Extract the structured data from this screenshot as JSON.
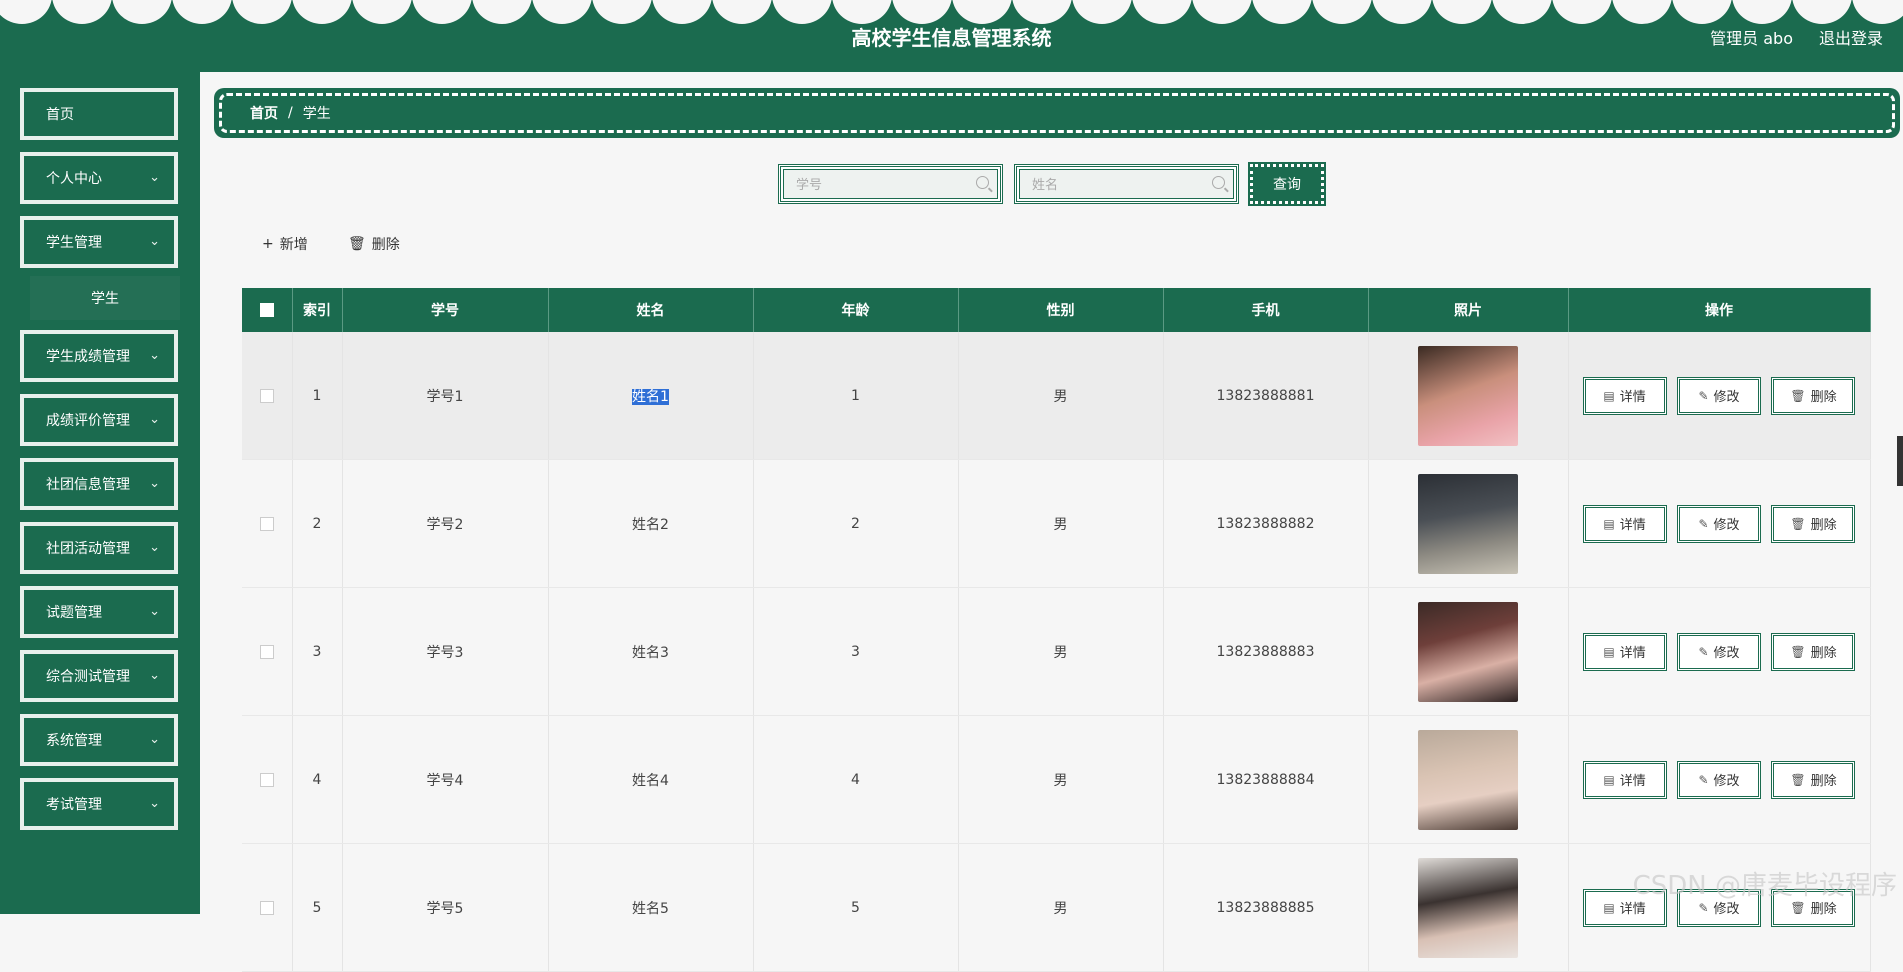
{
  "header": {
    "title": "高校学生信息管理系统",
    "admin_label": "管理员 abo",
    "logout_label": "退出登录"
  },
  "sidebar": {
    "items": [
      {
        "label": "首页",
        "expandable": false
      },
      {
        "label": "个人中心",
        "expandable": true
      },
      {
        "label": "学生管理",
        "expandable": true
      },
      {
        "label": "学生成绩管理",
        "expandable": true
      },
      {
        "label": "成绩评价管理",
        "expandable": true
      },
      {
        "label": "社团信息管理",
        "expandable": true
      },
      {
        "label": "社团活动管理",
        "expandable": true
      },
      {
        "label": "试题管理",
        "expandable": true
      },
      {
        "label": "综合测试管理",
        "expandable": true
      },
      {
        "label": "系统管理",
        "expandable": true
      },
      {
        "label": "考试管理",
        "expandable": true
      }
    ],
    "submenu_active": "学生"
  },
  "breadcrumb": {
    "home": "首页",
    "separator": "/",
    "current": "学生"
  },
  "search": {
    "student_no_placeholder": "学号",
    "name_placeholder": "姓名",
    "query_label": "查询"
  },
  "actions": {
    "add_label": "新增",
    "delete_label": "删除"
  },
  "table": {
    "columns": [
      "索引",
      "学号",
      "姓名",
      "年龄",
      "性别",
      "手机",
      "照片",
      "操作"
    ],
    "rows": [
      {
        "index": "1",
        "student_no": "学号1",
        "name": "姓名1",
        "age": "1",
        "gender": "男",
        "phone": "13823888881"
      },
      {
        "index": "2",
        "student_no": "学号2",
        "name": "姓名2",
        "age": "2",
        "gender": "男",
        "phone": "13823888882"
      },
      {
        "index": "3",
        "student_no": "学号3",
        "name": "姓名3",
        "age": "3",
        "gender": "男",
        "phone": "13823888883"
      },
      {
        "index": "4",
        "student_no": "学号4",
        "name": "姓名4",
        "age": "4",
        "gender": "男",
        "phone": "13823888884"
      },
      {
        "index": "5",
        "student_no": "学号5",
        "name": "姓名5",
        "age": "5",
        "gender": "男",
        "phone": "13823888885"
      }
    ],
    "row_actions": {
      "detail_label": "详情",
      "edit_label": "修改",
      "delete_label": "删除"
    }
  },
  "watermark": "CSDN @唐麦毕设程序",
  "colors": {
    "primary": "#1b6b4f",
    "background": "#f6f6f6",
    "selection": "#2f6fd6"
  }
}
